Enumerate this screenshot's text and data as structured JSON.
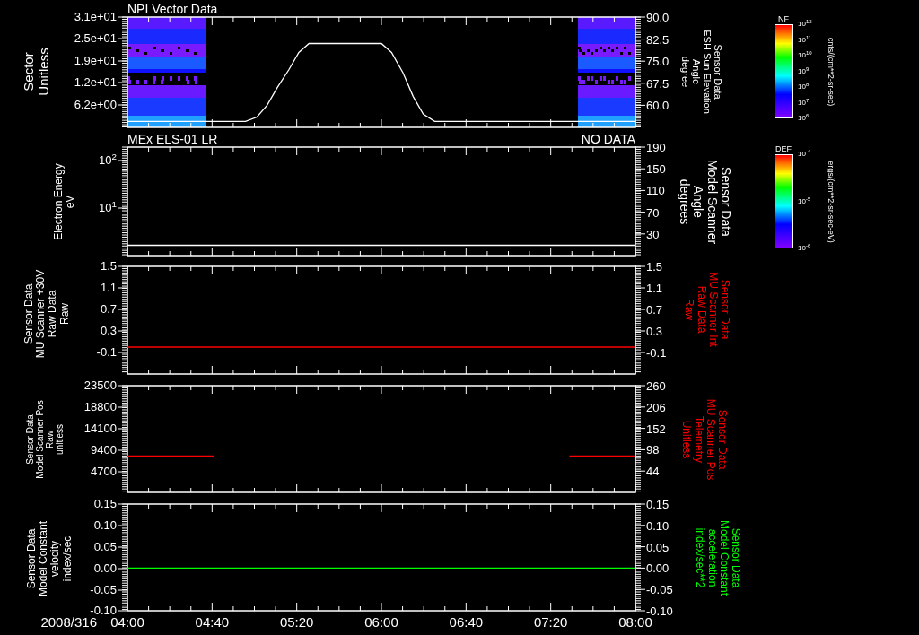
{
  "panels": [
    {
      "title": "NPI Vector Data",
      "y_left": {
        "label_lines": [
          "Sector",
          "Unitless"
        ],
        "ticks": [
          "3.1e+01",
          "2.5e+01",
          "1.9e+01",
          "1.2e+01",
          "6.2e+00"
        ]
      },
      "y_right": {
        "label_lines": [
          "Sensor Data",
          "ESH Sun Elevation",
          "Angle",
          "degree"
        ],
        "color": "#ffffff"
      },
      "chart_data": {
        "type": "line",
        "xlim": [
          4,
          8
        ],
        "ylim": [
          52.5,
          90
        ],
        "yticks": [
          {
            "value": 90,
            "label": "90.0"
          },
          {
            "value": 82.5,
            "label": "82.5"
          },
          {
            "value": 75,
            "label": "75.0"
          },
          {
            "value": 67.5,
            "label": "67.5"
          },
          {
            "value": 60,
            "label": "60.0"
          }
        ],
        "x": [
          4,
          4.93,
          5.02,
          5.1,
          5.18,
          5.27,
          5.35,
          5.43,
          6,
          6.08,
          6.17,
          6.25,
          6.33,
          6.42,
          8
        ],
        "series": [
          {
            "color": "#ffffff",
            "values": [
              54.5,
              54.5,
              56,
              60,
              66,
              72,
              78,
              81,
              81,
              78,
              71,
              63,
              57,
              54.5,
              54.5
            ]
          }
        ]
      }
    },
    {
      "title": "MEx ELS-01 LR",
      "title_right": "NO DATA",
      "y_left": {
        "label_lines": [
          "Electron Energy",
          "eV"
        ],
        "ticks": [
          "10$^{2}$",
          "10$^{1}$"
        ]
      },
      "y_right": {
        "label_lines": [
          "Sensor Data",
          "Model Scanner",
          "Angle",
          "degrees"
        ],
        "color": "#ffffff"
      },
      "chart_data": {
        "type": "line",
        "xlim": [
          4,
          8
        ],
        "ylim": [
          -10,
          190
        ],
        "yticks": [
          {
            "value": 190,
            "label": "190"
          },
          {
            "value": 150,
            "label": "150"
          },
          {
            "value": 110,
            "label": "110"
          },
          {
            "value": 70,
            "label": "70"
          },
          {
            "value": 30,
            "label": "30"
          }
        ],
        "x": [
          4,
          8
        ],
        "series": [
          {
            "color": "#ffffff",
            "values": [
              9,
              9
            ]
          }
        ]
      }
    },
    {
      "y_left": {
        "label_lines": [
          "Sensor Data",
          "MU Scanner +30V",
          "Raw Data",
          "Raw"
        ],
        "ticks": [
          "1.5",
          "1.1",
          "0.7",
          "0.3",
          "-0.1"
        ]
      },
      "y_right": {
        "label_lines": [
          "Sensor Data",
          "MU Scanner Int",
          "Raw Data",
          "Raw"
        ],
        "color": "#ff0000"
      },
      "chart_data": {
        "type": "line",
        "xlim": [
          4,
          8
        ],
        "ylim": [
          -0.5,
          1.5
        ],
        "yticks": [
          {
            "value": 1.5,
            "label": "1.5"
          },
          {
            "value": 1.1,
            "label": "1.1"
          },
          {
            "value": 0.7,
            "label": "0.7"
          },
          {
            "value": 0.3,
            "label": "0.3"
          },
          {
            "value": -0.1,
            "label": "-0.1"
          }
        ],
        "x": [
          4,
          8
        ],
        "series": [
          {
            "color": "#ff0000",
            "values": [
              0,
              0
            ]
          }
        ]
      }
    },
    {
      "y_left": {
        "label_lines": [
          "Sensor Data",
          "Model Scanner Pos",
          "Raw",
          "unitless"
        ],
        "ticks": [
          "23500",
          "18800",
          "14100",
          "9400",
          "4700"
        ]
      },
      "y_right": {
        "label_lines": [
          "Sensor Data",
          "MU Scanner Pos",
          "Telemetry",
          "Unitless"
        ],
        "color": "#ff0000"
      },
      "chart_data": {
        "type": "line",
        "xlim": [
          4,
          8
        ],
        "ylim": [
          -10,
          260
        ],
        "yticks": [
          {
            "value": 260,
            "label": "260"
          },
          {
            "value": 206,
            "label": "206"
          },
          {
            "value": 152,
            "label": "152"
          },
          {
            "value": 98,
            "label": "98"
          },
          {
            "value": 44,
            "label": "44"
          }
        ],
        "x": [
          4,
          4.68,
          6.08,
          7.48,
          8
        ],
        "series": [
          {
            "color": "#ff0000",
            "values": [
              82,
              82,
              null,
              82,
              82
            ]
          }
        ]
      }
    },
    {
      "y_left": {
        "label_lines": [
          "Sensor Data",
          "Model Constant",
          "velocity",
          "index/sec"
        ],
        "ticks": [
          "0.15",
          "0.10",
          "0.05",
          "0.00",
          "-0.05",
          "-0.10"
        ]
      },
      "y_right": {
        "label_lines": [
          "Sensor Data",
          "Model Constant",
          "acceleration",
          "index/sec**2"
        ],
        "color": "#00ff00"
      },
      "chart_data": {
        "type": "line",
        "xlim": [
          4,
          8
        ],
        "ylim": [
          -0.1,
          0.15
        ],
        "yticks": [
          {
            "value": 0.15,
            "label": "0.15"
          },
          {
            "value": 0.1,
            "label": "0.10"
          },
          {
            "value": 0.05,
            "label": "0.05"
          },
          {
            "value": 0,
            "label": "0.00"
          },
          {
            "value": -0.05,
            "label": "-0.05"
          },
          {
            "value": -0.1,
            "label": "-0.10"
          }
        ],
        "xticks": [
          {
            "value": 4,
            "label": "04:00"
          },
          {
            "value": 4.6667,
            "label": "04:40"
          },
          {
            "value": 5.3333,
            "label": "05:20"
          },
          {
            "value": 6,
            "label": "06:00"
          },
          {
            "value": 6.6667,
            "label": "06:40"
          },
          {
            "value": 7.3333,
            "label": "07:20"
          },
          {
            "value": 8,
            "label": "08:00"
          }
        ],
        "x": [
          4,
          8
        ],
        "series": [
          {
            "color": "#00ff00",
            "values": [
              0,
              0
            ]
          }
        ]
      }
    }
  ],
  "date_label": "2008/316",
  "colorbars": [
    {
      "title": "NF",
      "ticks": [
        "10$^{12}$",
        "10$^{11}$",
        "10$^{10}$",
        "10$^{9}$",
        "10$^{8}$",
        "10$^{7}$",
        "10$^{6}$"
      ],
      "units": "cnts/(cm**2-sr-sec)"
    },
    {
      "title": "DEF",
      "ticks": [
        "10$^{-4}$",
        "10$^{-5}$",
        "10$^{-6}$"
      ],
      "units": "ergs/(cm**2-sr-sec-eV)"
    }
  ]
}
